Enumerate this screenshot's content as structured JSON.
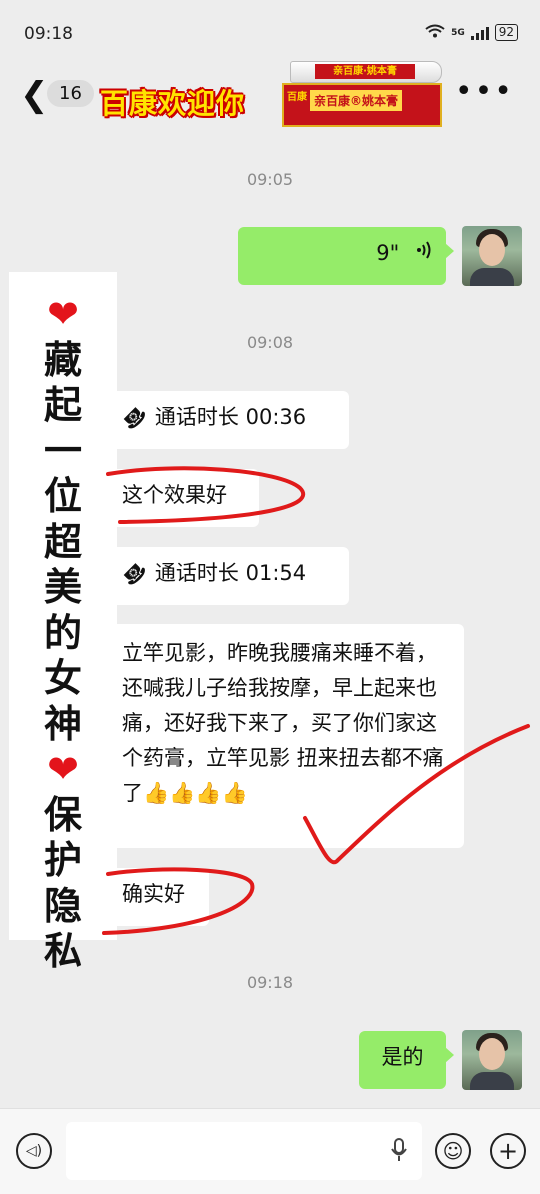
{
  "status_bar": {
    "time": "09:18",
    "network": "5G",
    "battery": "92"
  },
  "header": {
    "back_glyph": "❮",
    "unread_count": "16",
    "title": "百康欢迎你",
    "more_glyph": "•••",
    "product_tube_label": "亲百康·姚本膏",
    "product_box_label": "亲百康®姚本膏",
    "product_brand": "百康"
  },
  "messages": {
    "ts1": "09:05",
    "voice_duration": "9\"",
    "voice_icon": "⦅",
    "ts2": "09:08",
    "call1_icon": "☎",
    "call1": "通话时长 00:36",
    "text1": "这个效果好",
    "call2_icon": "☎",
    "call2": "通话时长 01:54",
    "text2": "立竿见影，昨晚我腰痛来睡不着，还喊我儿子给我按摩，早上起来也痛，还好我下来了，买了你们家这个药膏，立竿见影 扭来扭去都不痛了👍👍👍👍",
    "text3": "确实好",
    "ts3": "09:18",
    "reply": "是的"
  },
  "overlay_text": "❤️藏起一位超美的女神❤️保护隐私",
  "input_bar": {
    "voice_toggle": "◁)",
    "mic": "🎙",
    "emoji": "☺",
    "plus": "+"
  },
  "colors": {
    "background": "#ededed",
    "sent_bubble": "#95ec69",
    "received_bubble": "#ffffff",
    "annotation_red": "#e01a1a"
  }
}
